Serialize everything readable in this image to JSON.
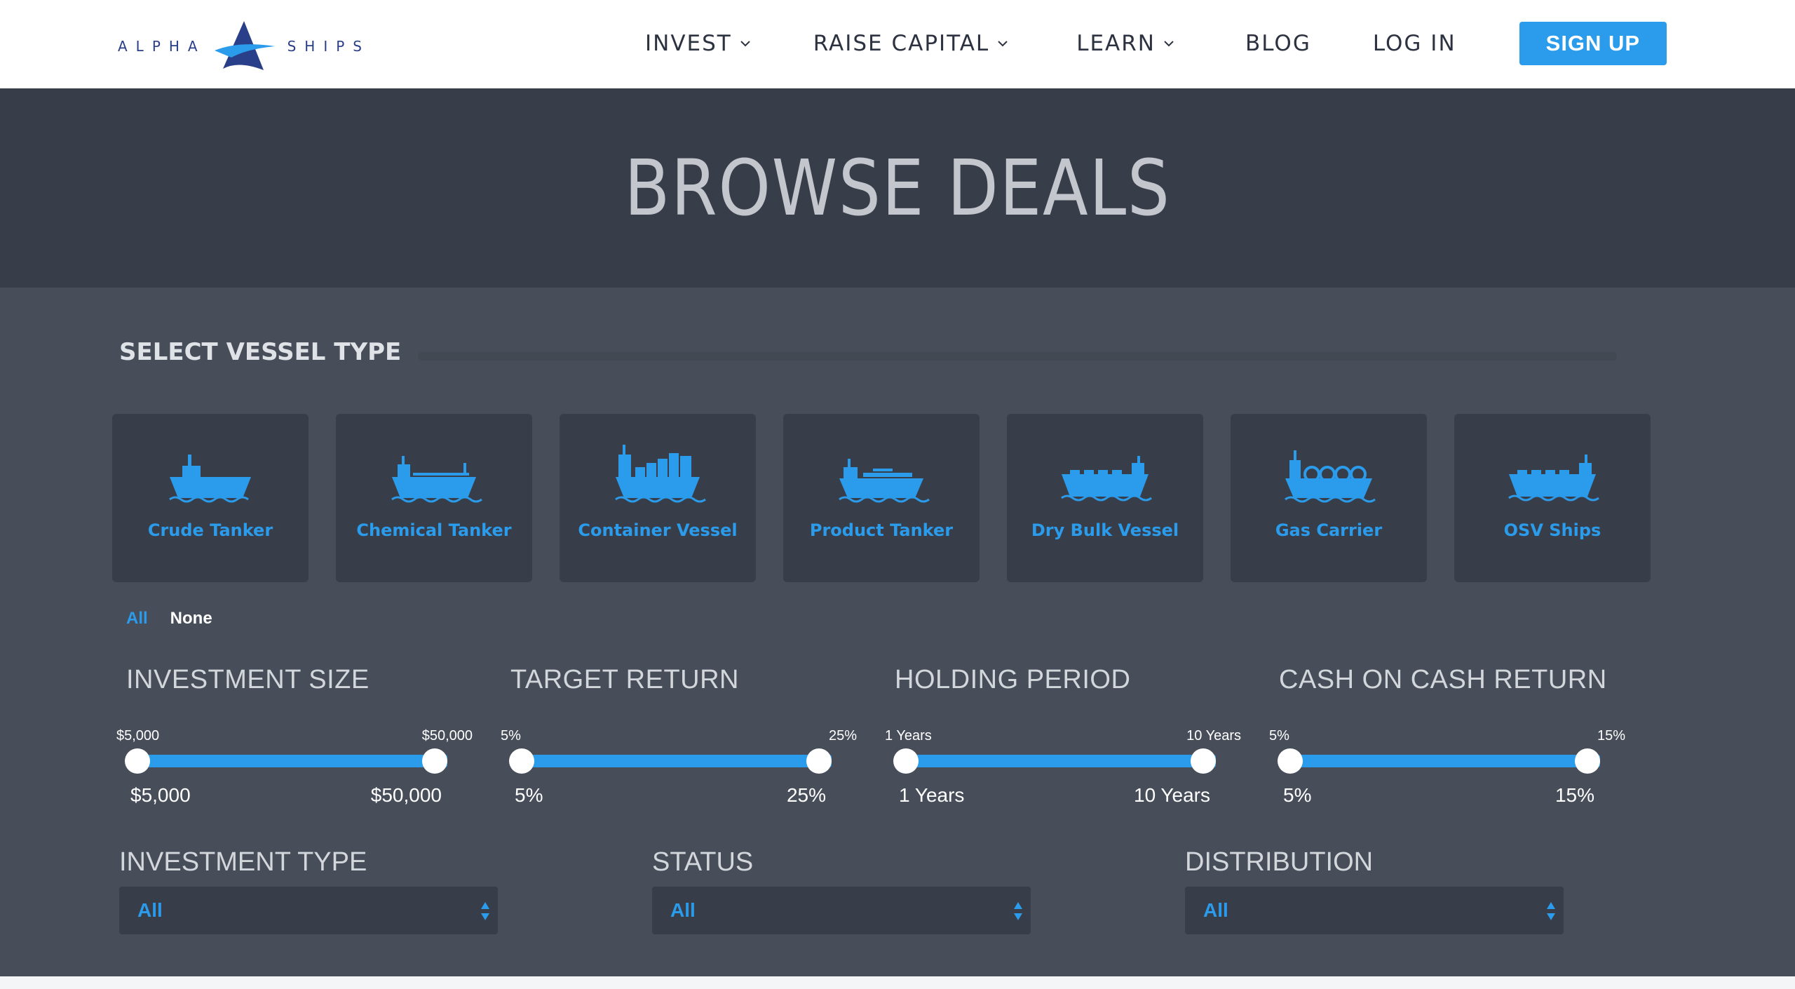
{
  "brand": {
    "left_word": "ALPHA",
    "right_word": "SHIPS",
    "accent_color": "#2b9bec",
    "logo_color": "#2a3f8a"
  },
  "nav": {
    "items": [
      {
        "label": "INVEST",
        "has_dropdown": true
      },
      {
        "label": "RAISE CAPITAL",
        "has_dropdown": true
      },
      {
        "label": "LEARN",
        "has_dropdown": true
      },
      {
        "label": "BLOG",
        "has_dropdown": false
      },
      {
        "label": "LOG IN",
        "has_dropdown": false
      }
    ],
    "signup_label": "SIGN UP"
  },
  "hero": {
    "title": "BROWSE DEALS"
  },
  "vessel_section": {
    "title": "SELECT VESSEL TYPE",
    "vessels": [
      {
        "label": "Crude Tanker",
        "icon": "crude-tanker-icon"
      },
      {
        "label": "Chemical Tanker",
        "icon": "chemical-tanker-icon"
      },
      {
        "label": "Container Vessel",
        "icon": "container-vessel-icon"
      },
      {
        "label": "Product Tanker",
        "icon": "product-tanker-icon"
      },
      {
        "label": "Dry Bulk Vessel",
        "icon": "dry-bulk-vessel-icon"
      },
      {
        "label": "Gas Carrier",
        "icon": "gas-carrier-icon"
      },
      {
        "label": "OSV Ships",
        "icon": "osv-ships-icon"
      }
    ],
    "select_all": "All",
    "select_none": "None"
  },
  "ranges": [
    {
      "title": "INVESTMENT SIZE",
      "bound_lo": "$5,000",
      "bound_hi": "$50,000",
      "value_lo": "$5,000",
      "value_hi": "$50,000"
    },
    {
      "title": "TARGET RETURN",
      "bound_lo": "5%",
      "bound_hi": "25%",
      "value_lo": "5%",
      "value_hi": "25%"
    },
    {
      "title": "HOLDING PERIOD",
      "bound_lo": "1 Years",
      "bound_hi": "10 Years",
      "value_lo": "1 Years",
      "value_hi": "10 Years"
    },
    {
      "title": "CASH ON CASH RETURN",
      "bound_lo": "5%",
      "bound_hi": "15%",
      "value_lo": "5%",
      "value_hi": "15%"
    }
  ],
  "dropdowns": [
    {
      "title": "INVESTMENT TYPE",
      "value": "All"
    },
    {
      "title": "STATUS",
      "value": "All"
    },
    {
      "title": "DISTRIBUTION",
      "value": "All"
    }
  ]
}
